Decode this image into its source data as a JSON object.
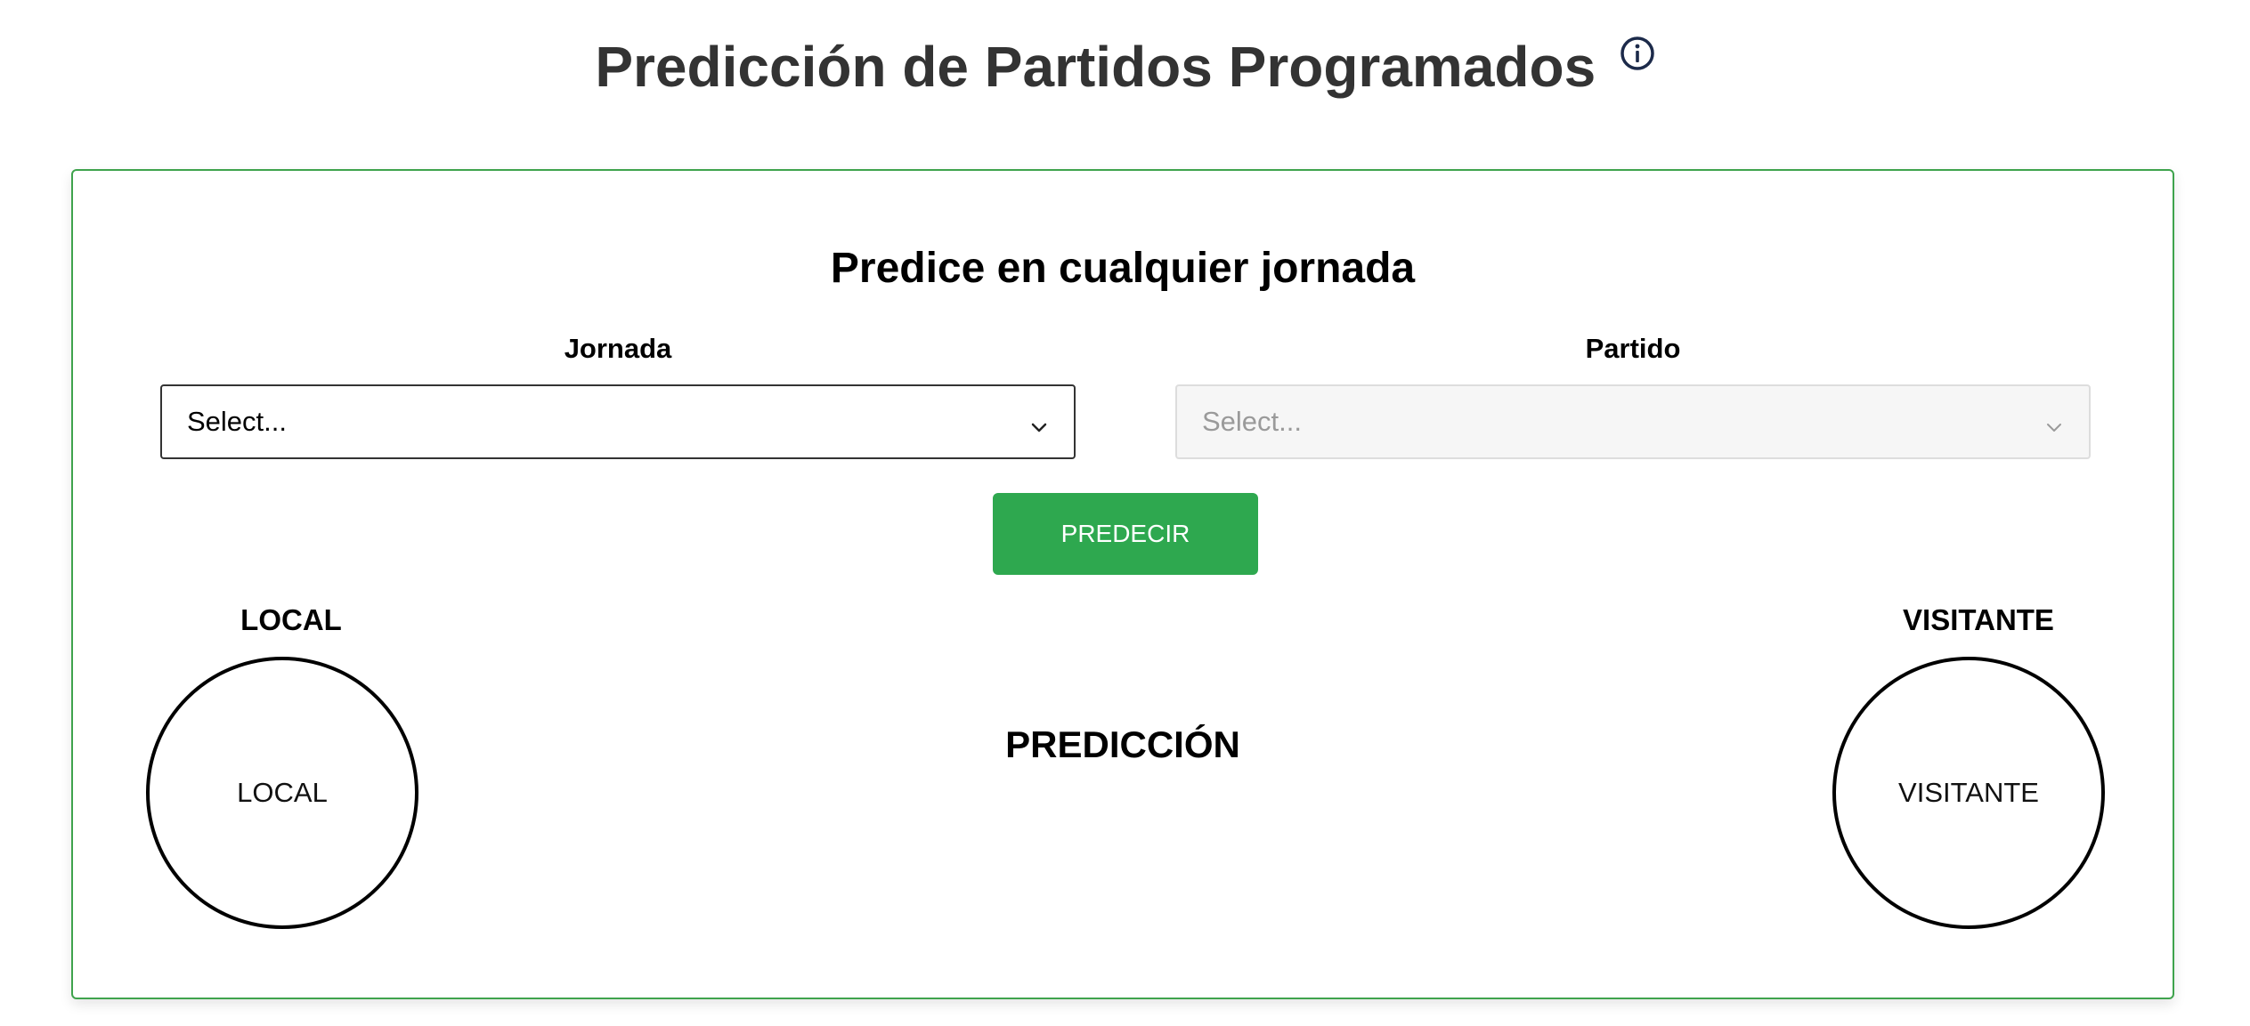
{
  "header": {
    "title": "Predicción de Partidos Programados",
    "info_icon": "info-icon"
  },
  "predictor": {
    "title": "Predice en cualquier jornada",
    "jornada": {
      "label": "Jornada",
      "placeholder": "Select..."
    },
    "partido": {
      "label": "Partido",
      "placeholder": "Select...",
      "disabled": true
    },
    "predict_button_label": "PREDECIR",
    "local": {
      "heading": "LOCAL",
      "circle_label": "LOCAL"
    },
    "visitante": {
      "heading": "VISITANTE",
      "circle_label": "VISITANTE"
    },
    "prediction_heading": "PREDICCIÓN"
  },
  "colors": {
    "accent_green": "#2ea84f",
    "card_border": "#3fa34d",
    "title_text": "#333333",
    "info_icon": "#1c2a4a"
  }
}
